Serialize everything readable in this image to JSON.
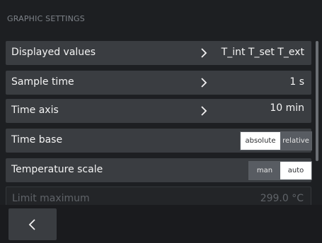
{
  "header": {
    "title": "GRAPHIC SETTINGS"
  },
  "rows": {
    "displayed_values": {
      "label": "Displayed values",
      "value": "T_int T_set T_ext",
      "chevron_icon": "chevron-right-icon"
    },
    "sample_time": {
      "label": "Sample time",
      "value": "1 s",
      "chevron_icon": "chevron-right-icon"
    },
    "time_axis": {
      "label": "Time axis",
      "value": "10 min",
      "chevron_icon": "chevron-right-icon"
    },
    "time_base": {
      "label": "Time base",
      "options": [
        "absolute",
        "relative"
      ],
      "selected": "absolute"
    },
    "temperature_scale": {
      "label": "Temperature scale",
      "options": [
        "man",
        "auto"
      ],
      "selected": "auto"
    },
    "limit_maximum": {
      "label": "Limit maximum",
      "value": "299.0 °C"
    }
  },
  "footer": {
    "back_icon": "chevron-left-icon"
  },
  "colors": {
    "background": "#1d1f22",
    "row": "#3a3d41",
    "active_segment": "#ffffff",
    "inactive_segment": "#585c62"
  }
}
